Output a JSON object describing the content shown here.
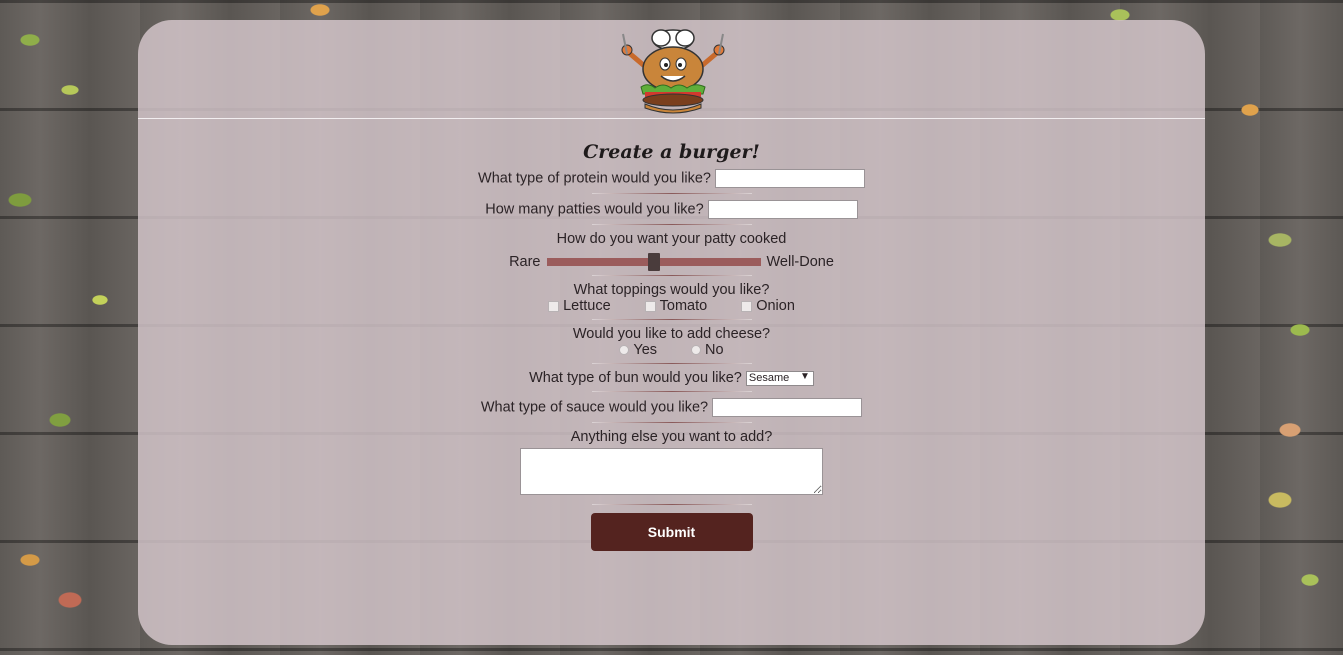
{
  "form": {
    "title": "Create a burger!",
    "protein_label": "What type of protein would you like?",
    "protein_value": "",
    "patties_label": "How many patties would you like?",
    "patties_value": "",
    "cooked_label": "How do you want your patty cooked",
    "cooked_min_label": "Rare",
    "cooked_max_label": "Well-Done",
    "cooked_level": 0.5,
    "toppings_label": "What toppings would you like?",
    "toppings": [
      {
        "label": "Lettuce",
        "checked": false
      },
      {
        "label": "Tomato",
        "checked": false
      },
      {
        "label": "Onion",
        "checked": false
      }
    ],
    "cheese_label": "Would you like to add cheese?",
    "cheese_options": [
      {
        "label": "Yes",
        "selected": false
      },
      {
        "label": "No",
        "selected": false
      }
    ],
    "bun_label": "What type of bun would you like?",
    "bun_selected": "Sesame",
    "sauce_label": "What type of sauce would you like?",
    "sauce_value": "",
    "extra_label": "Anything else you want to add?",
    "extra_value": "",
    "submit_label": "Submit"
  },
  "colors": {
    "panel": "#d7c8cd",
    "submit_bg": "#54231f",
    "slider_track": "#9b5c5c"
  },
  "icons": {
    "logo": "burger-chef-mascot-icon"
  }
}
